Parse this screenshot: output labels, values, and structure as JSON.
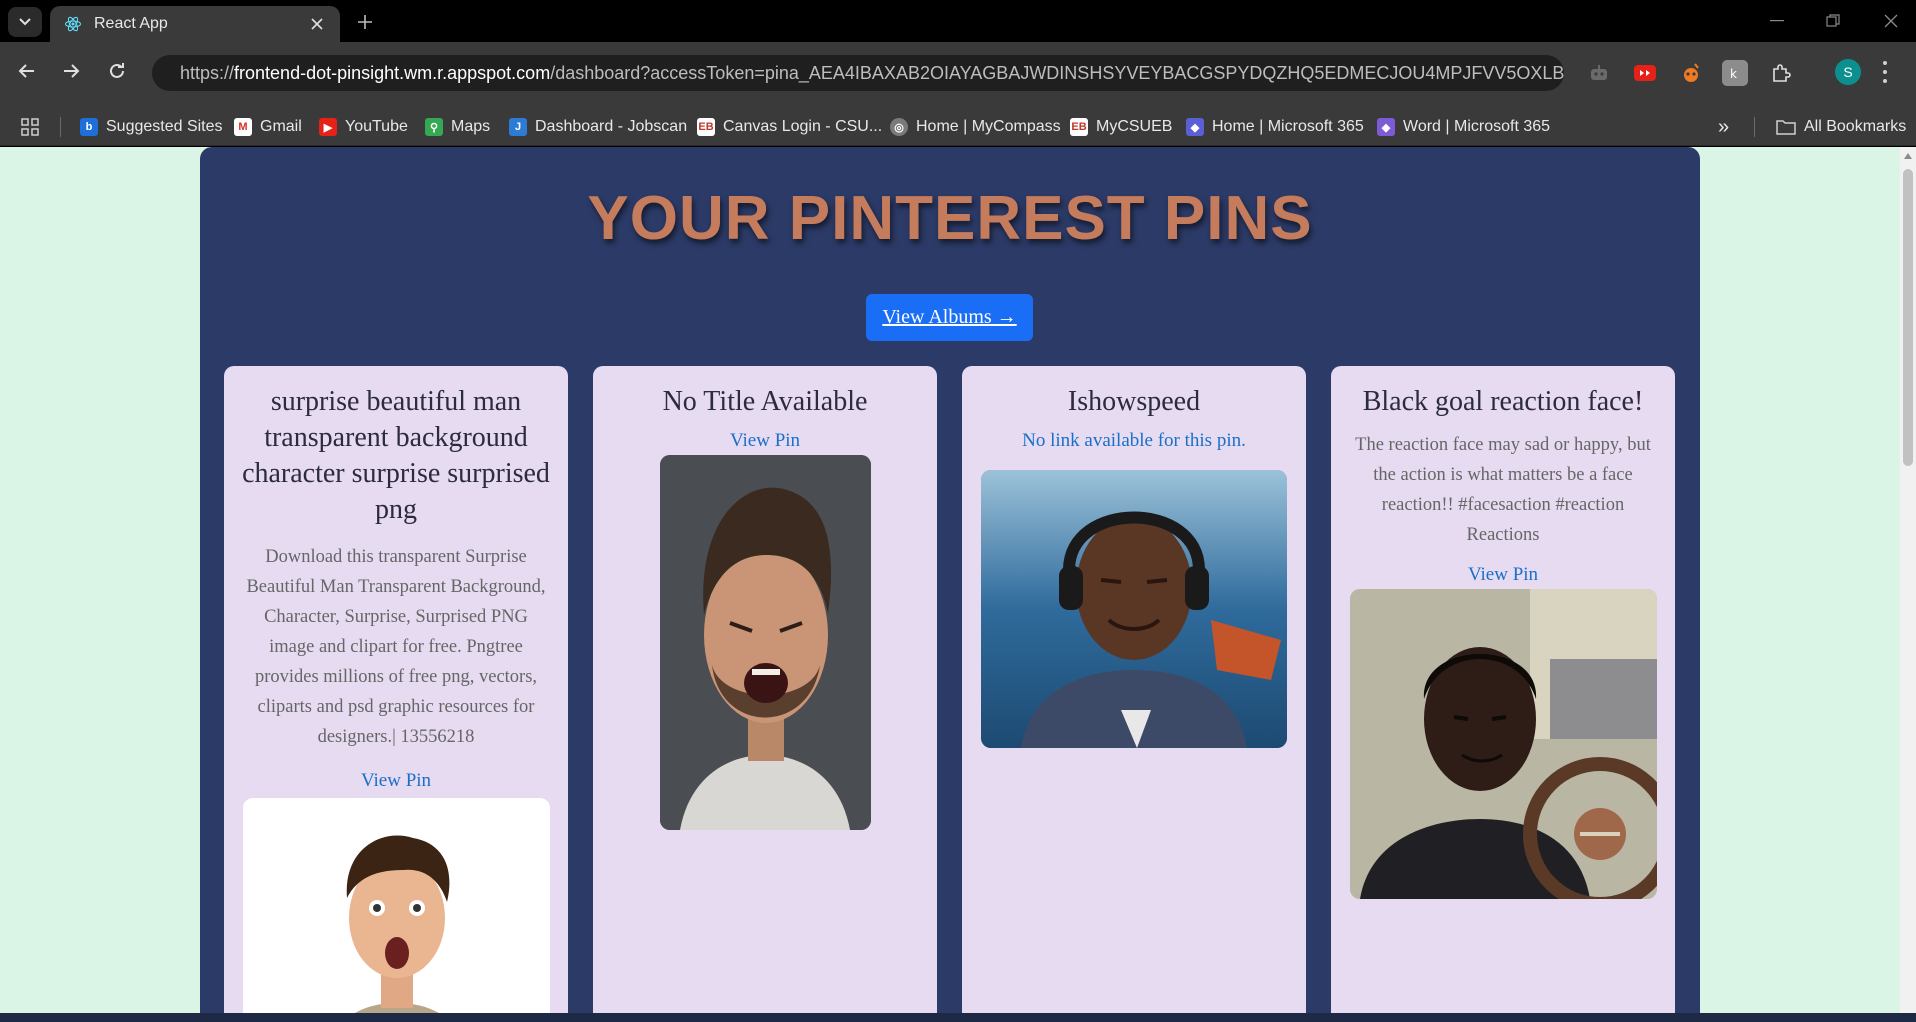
{
  "browser": {
    "tab_title": "React App",
    "url_prefix": "https://",
    "url_host": "frontend-dot-pinsight.wm.r.appspot.com",
    "url_path": "/dashboard?accessToken=pina_AEA4IBAXAB2OIAYAGBAJWDINSHSYVEYBACGSPYDQZHQ5EDMECJOU4MPJFVV5OXLB5YGG...",
    "profile_initial": "S"
  },
  "bookmarks": [
    {
      "label": "Suggested Sites",
      "icon": "bing-icon"
    },
    {
      "label": "Gmail",
      "icon": "gmail-icon"
    },
    {
      "label": "YouTube",
      "icon": "youtube-icon"
    },
    {
      "label": "Maps",
      "icon": "maps-icon"
    },
    {
      "label": "Dashboard - Jobscan",
      "icon": "jobscan-icon"
    },
    {
      "label": "Canvas Login - CSU...",
      "icon": "canvas-icon"
    },
    {
      "label": "Home | MyCompass",
      "icon": "mycompass-icon"
    },
    {
      "label": "MyCSUEB",
      "icon": "mycsueb-icon"
    },
    {
      "label": "Home | Microsoft 365",
      "icon": "m365-icon"
    },
    {
      "label": "Word | Microsoft 365",
      "icon": "word-icon"
    }
  ],
  "bookmarks_overflow": "»",
  "all_bookmarks": "All Bookmarks",
  "page": {
    "title": "YOUR PINTEREST PINS",
    "albums_button": "View Albums →",
    "pins": [
      {
        "title": "surprise beautiful man transparent background character surprise surprised png",
        "description": "Download this transparent Surprise Beautiful Man Transparent Background, Character, Surprise, Surprised PNG image and clipart for free. Pngtree provides millions of free png, vectors, cliparts and psd graphic resources for designers.| 13556218",
        "link": "View Pin"
      },
      {
        "title": "No Title Available",
        "description": "",
        "link": "View Pin"
      },
      {
        "title": "Ishowspeed",
        "description": "",
        "link": "No link available for this pin."
      },
      {
        "title": "Black goal reaction face!",
        "description": "The reaction face may sad or happy, but the action is what matters be a face reaction!! #facesaction #reaction Reactions",
        "link": "View Pin"
      }
    ]
  },
  "colors": {
    "page_bg": "#daf5e6",
    "panel_bg": "#2c3a67",
    "title": "#c47c5c",
    "button": "#1a6ef5",
    "card_bg": "#e6dbf1",
    "link": "#1a6fc8"
  }
}
